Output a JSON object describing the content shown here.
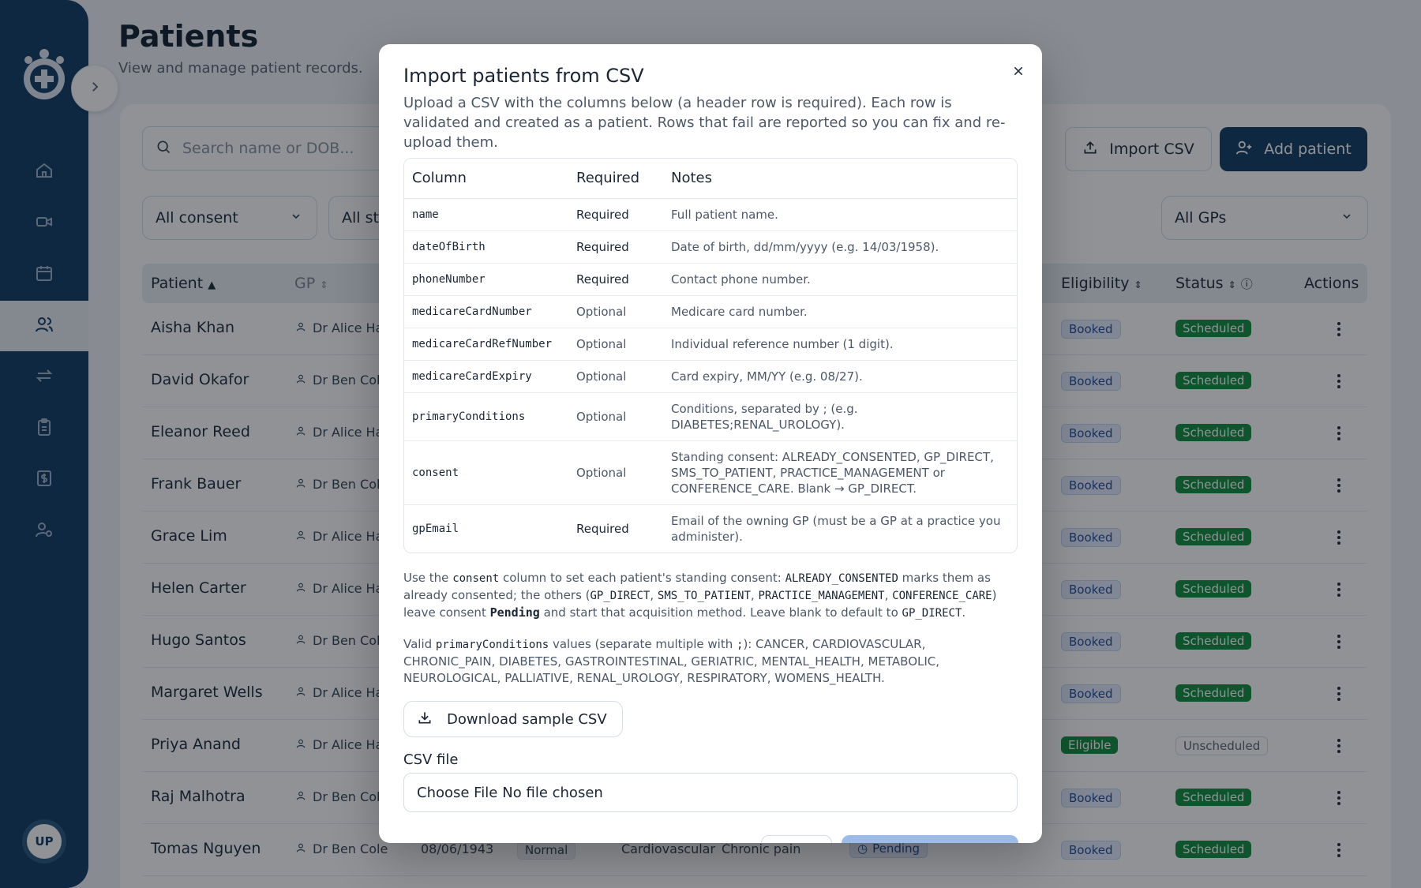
{
  "page": {
    "title": "Patients",
    "subtitle": "View and manage patient records."
  },
  "sidebar": {
    "avatar_initials": "UP",
    "items": [
      "home-icon",
      "video-icon",
      "calendar-icon",
      "users-icon",
      "transfer-icon",
      "clipboard-icon",
      "billing-icon",
      "user-settings-icon"
    ]
  },
  "toolbar": {
    "search_placeholder": "Search name or DOB...",
    "import_label": "Import CSV",
    "add_label": "Add patient"
  },
  "filters": {
    "consent": "All consent",
    "status_partial": "All sta",
    "gp": "All GPs"
  },
  "table": {
    "headers": {
      "patient": "Patient",
      "gp": "GP",
      "eligibility": "Eligibility",
      "status": "Status",
      "actions": "Actions"
    },
    "rows": [
      {
        "name": "Aisha Khan",
        "gp": "Dr Alice Ha",
        "eligibility": "Booked",
        "status": "Scheduled"
      },
      {
        "name": "David Okafor",
        "gp": "Dr Ben Cole",
        "eligibility": "Booked",
        "status": "Scheduled"
      },
      {
        "name": "Eleanor Reed",
        "gp": "Dr Alice Ha",
        "eligibility": "Booked",
        "status": "Scheduled"
      },
      {
        "name": "Frank Bauer",
        "gp": "Dr Ben Cole",
        "eligibility": "Booked",
        "status": "Scheduled"
      },
      {
        "name": "Grace Lim",
        "gp": "Dr Alice Ha",
        "eligibility": "Booked",
        "status": "Scheduled"
      },
      {
        "name": "Helen Carter",
        "gp": "Dr Alice Ha",
        "eligibility": "Booked",
        "status": "Scheduled"
      },
      {
        "name": "Hugo Santos",
        "gp": "Dr Ben Cole",
        "eligibility": "Booked",
        "status": "Scheduled"
      },
      {
        "name": "Margaret Wells",
        "gp": "Dr Alice Ha",
        "eligibility": "Booked",
        "status": "Scheduled"
      },
      {
        "name": "Priya Anand",
        "gp": "Dr Alice Ha",
        "eligibility": "Eligible",
        "status": "Unscheduled"
      },
      {
        "name": "Raj Malhotra",
        "gp": "Dr Ben Cole",
        "eligibility": "Booked",
        "status": "Scheduled"
      },
      {
        "name": "Tomas Nguyen",
        "gp": "Dr Ben Cole",
        "dob": "08/06/1943",
        "risk": "Normal",
        "condition1": "Cardiovascular",
        "condition2": "Chronic pain",
        "consent": "Pending",
        "eligibility": "Booked",
        "status": "Scheduled"
      }
    ]
  },
  "modal": {
    "title": "Import patients from CSV",
    "description": "Upload a CSV with the columns below (a header row is required). Each row is validated and created as a patient. Rows that fail are reported so you can fix and re-upload them.",
    "columns_header": {
      "column": "Column",
      "required": "Required",
      "notes": "Notes"
    },
    "columns": [
      {
        "column": "name",
        "required": "Required",
        "notes": "Full patient name."
      },
      {
        "column": "dateOfBirth",
        "required": "Required",
        "notes": "Date of birth, dd/mm/yyyy (e.g. 14/03/1958)."
      },
      {
        "column": "phoneNumber",
        "required": "Required",
        "notes": "Contact phone number."
      },
      {
        "column": "medicareCardNumber",
        "required": "Optional",
        "notes": "Medicare card number."
      },
      {
        "column": "medicareCardRefNumber",
        "required": "Optional",
        "notes": "Individual reference number (1 digit)."
      },
      {
        "column": "medicareCardExpiry",
        "required": "Optional",
        "notes": "Card expiry, MM/YY (e.g. 08/27)."
      },
      {
        "column": "primaryConditions",
        "required": "Optional",
        "notes": "Conditions, separated by ; (e.g. DIABETES;RENAL_UROLOGY)."
      },
      {
        "column": "consent",
        "required": "Optional",
        "notes": "Standing consent: ALREADY_CONSENTED, GP_DIRECT, SMS_TO_PATIENT, PRACTICE_MANAGEMENT or CONFERENCE_CARE. Blank → GP_DIRECT."
      },
      {
        "column": "gpEmail",
        "required": "Required",
        "notes": "Email of the owning GP (must be a GP at a practice you administer)."
      }
    ],
    "consent_note": {
      "p1": "Use the ",
      "c1": "consent",
      "p2": " column to set each patient's standing consent: ",
      "c2": "ALREADY_CONSENTED",
      "p3": " marks them as already consented; the others (",
      "c3": "GP_DIRECT",
      "s1": ", ",
      "c4": "SMS_TO_PATIENT",
      "s2": ", ",
      "c5": "PRACTICE_MANAGEMENT",
      "s3": ", ",
      "c6": "CONFERENCE_CARE",
      "p4": ") leave consent ",
      "b1": "Pending",
      "p5": " and start that acquisition method. Leave blank to default to ",
      "c7": "GP_DIRECT",
      "p6": "."
    },
    "conditions_note": {
      "p1": "Valid ",
      "c1": "primaryConditions",
      "p2": " values (separate multiple with ",
      "c2": ";",
      "p3": "): CANCER, CARDIOVASCULAR, CHRONIC_PAIN, DIABETES, GASTROINTESTINAL, GERIATRIC, MENTAL_HEALTH, METABOLIC, NEUROLOGICAL, PALLIATIVE, RENAL_UROLOGY, RESPIRATORY, WOMENS_HEALTH."
    },
    "download_label": "Download sample CSV",
    "file_label": "CSV file",
    "choose_file": "Choose File",
    "no_file": "No file chosen"
  },
  "colors": {
    "brand": "#143f64",
    "scheduled": "#138f3f",
    "booked_bg": "#e4ecfb"
  }
}
